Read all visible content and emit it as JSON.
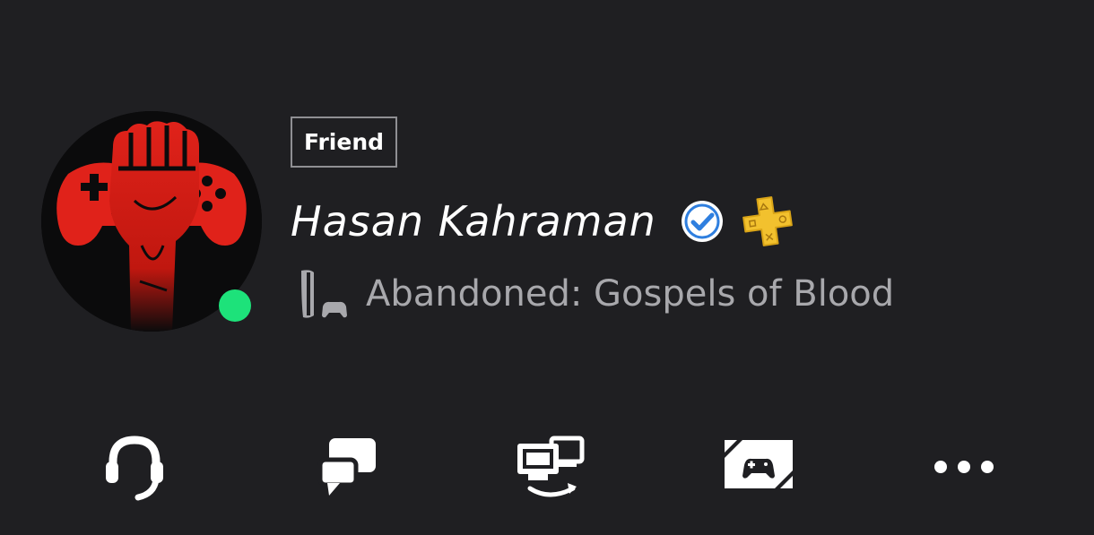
{
  "profile": {
    "relationship_badge": "Friend",
    "online_id": "Hasan Kahraman",
    "online_status": "online",
    "now_playing": "Abandoned: Gospels of Blood",
    "platform_icon": "ps5-console-icon",
    "verified_icon": "verified-check-icon",
    "subscription_icon": "ps-plus-icon"
  },
  "actions": [
    {
      "icon": "headset-icon",
      "label": "Voice chat"
    },
    {
      "icon": "chat-bubbles-icon",
      "label": "Message"
    },
    {
      "icon": "share-screen-icon",
      "label": "Share screen"
    },
    {
      "icon": "game-library-icon",
      "label": "Games"
    },
    {
      "icon": "more-options-icon",
      "label": "More"
    }
  ],
  "colors": {
    "background": "#1f1f22",
    "online_dot": "#1de27a",
    "badge_border": "#8f8f93",
    "secondary_text": "#a8a8ac",
    "plus_gold": "#f2c12e",
    "verified_blue": "#2f7fdf",
    "avatar_red": "#e0221a"
  }
}
